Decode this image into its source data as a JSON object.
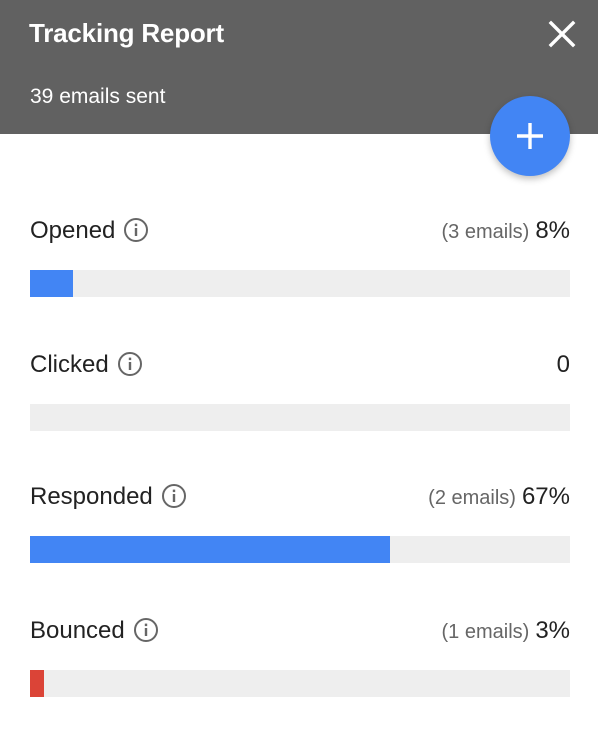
{
  "header": {
    "title": "Tracking Report",
    "subtitle": "39 emails sent",
    "background": "#616161"
  },
  "icons": {
    "close": "close-icon",
    "add": "plus-icon",
    "info": "info-icon"
  },
  "colors": {
    "accent": "#4285f4",
    "bounce": "#db4437",
    "track": "#eeeeee"
  },
  "metrics": [
    {
      "key": "opened",
      "label": "Opened",
      "count_text": "(3 emails)",
      "value_text": "8%",
      "fraction": 0.08,
      "color": "#4285f4"
    },
    {
      "key": "clicked",
      "label": "Clicked",
      "count_text": "",
      "value_text": "0",
      "fraction": 0,
      "color": "#4285f4"
    },
    {
      "key": "responded",
      "label": "Responded",
      "count_text": "(2 emails)",
      "value_text": "67%",
      "fraction": 0.667,
      "color": "#4285f4"
    },
    {
      "key": "bounced",
      "label": "Bounced",
      "count_text": "(1 emails)",
      "value_text": "3%",
      "fraction": 0.026,
      "color": "#db4437"
    }
  ]
}
